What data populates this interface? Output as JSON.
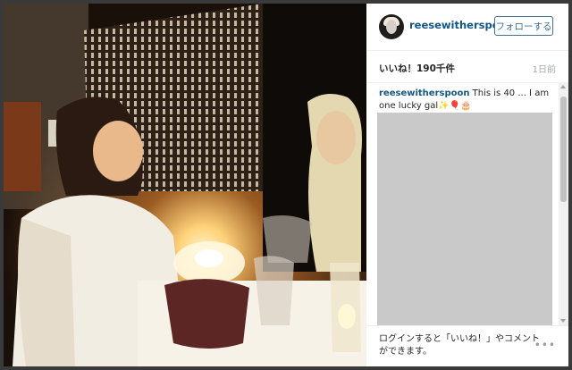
{
  "post": {
    "username": "reesewitherspoo..",
    "follow_label": "フォローする",
    "likes": "いいね！190千件",
    "time_ago": "1日前",
    "caption_user": "reesewitherspoon",
    "caption_text": " This is 40 ... I am one lucky gal✨🎈🎂",
    "login_prompt": "ログインすると「いいね！」やコメントができます。",
    "more_label": "•••"
  },
  "colors": {
    "link_blue": "#125688",
    "follow_border": "#3f729b",
    "placeholder_gray": "#c9c9c9"
  },
  "icons": {
    "more": "more-options-icon",
    "avatar": "user-avatar"
  }
}
